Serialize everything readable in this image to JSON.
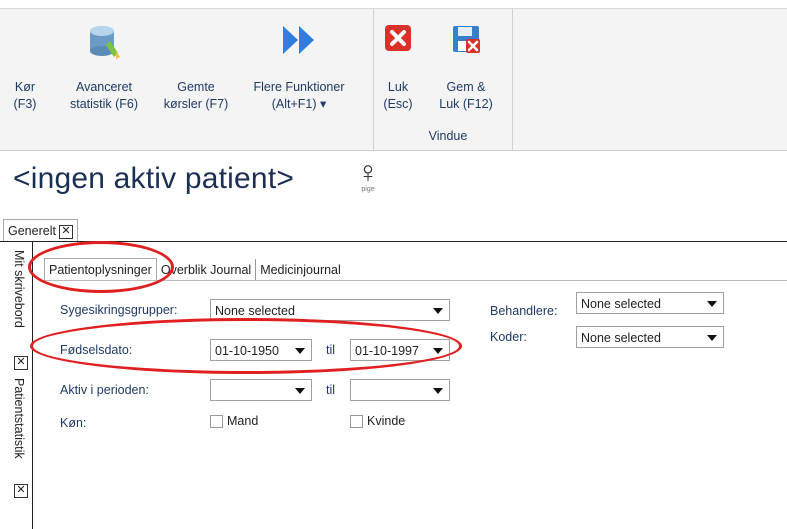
{
  "ribbon": {
    "run": {
      "line1": "Kør",
      "line2": "(F3)"
    },
    "advanced_stats": {
      "line1": "Avanceret",
      "line2": "statistik (F6)"
    },
    "saved_runs": {
      "line1": "Gemte",
      "line2": "kørsler (F7)"
    },
    "more_functions": {
      "line1": "Flere Funktioner",
      "line2": "(Alt+F1) ▾"
    },
    "close": {
      "line1": "Luk",
      "line2": "(Esc)"
    },
    "save_close": {
      "line1": "Gem &",
      "line2": "Luk (F12)"
    },
    "group_window": "Vindue"
  },
  "patient": {
    "title": "<ingen aktiv patient>",
    "gender_symbol": "♀",
    "gender_label": "pige"
  },
  "outer_tab": {
    "label": "Generelt",
    "close": "✕"
  },
  "side_tabs": [
    {
      "label": "Mit skrivebord",
      "close": "✕"
    },
    {
      "label": "Patientstatistik",
      "close": "✕"
    }
  ],
  "inner_tabs": [
    "Patientoplysninger",
    "Overblik Journal",
    "Medicinjournal"
  ],
  "form": {
    "insurance_label": "Sygesikringsgrupper:",
    "insurance_value": "None selected",
    "dob_label": "Fødselsdato:",
    "dob_from": "01-10-1950",
    "dob_til": "til",
    "dob_to": "01-10-1997",
    "active_label": "Aktiv i perioden:",
    "active_from": "",
    "active_til": "til",
    "active_to": "",
    "gender_label": "Køn:",
    "male": "Mand",
    "female": "Kvinde",
    "practitioners_label": "Behandlere:",
    "practitioners_value": "None selected",
    "codes_label": "Koder:",
    "codes_value": "None selected"
  },
  "colors": {
    "annotation": "#e02020",
    "label_blue": "#1f3a66"
  }
}
